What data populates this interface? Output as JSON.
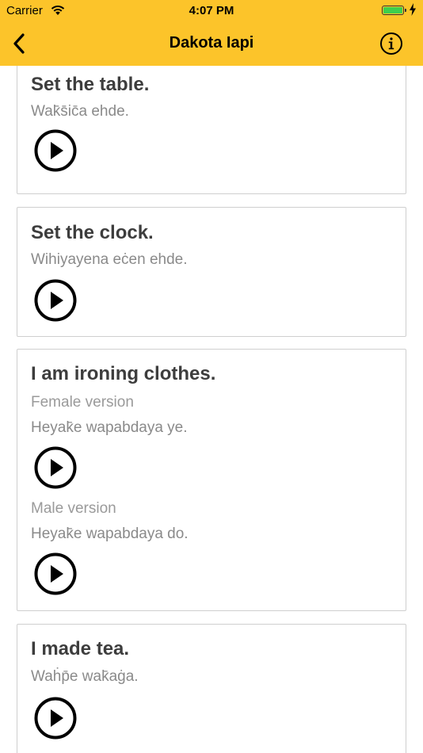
{
  "status_bar": {
    "carrier": "Carrier",
    "time": "4:07 PM",
    "battery_level": 1.0
  },
  "nav": {
    "title": "Dakota Iapi",
    "back_icon": "chevron-left-icon",
    "info_icon": "info-circle-icon"
  },
  "colors": {
    "nav_background": "#fcc42a",
    "title_text": "#3d3d3d",
    "secondary_text": "#8a8a8a",
    "card_border": "#cfcfcf",
    "battery": "#3ecf4d"
  },
  "cards": [
    {
      "title": "Set the table.",
      "phrase": "Wak̄s̄ic̄a ehde."
    },
    {
      "title": "Set the clock.",
      "phrase": "Wihiyayena eċen ehde."
    },
    {
      "title": "I am ironing clothes.",
      "female_label": "Female version",
      "female_phrase": "Heyak̄e wapabdaya ye.",
      "male_label": "Male version",
      "male_phrase": "Heyak̄e wapabdaya do."
    },
    {
      "title": "I made tea.",
      "phrase": "Waḣp̄e wak̄aġa."
    }
  ]
}
